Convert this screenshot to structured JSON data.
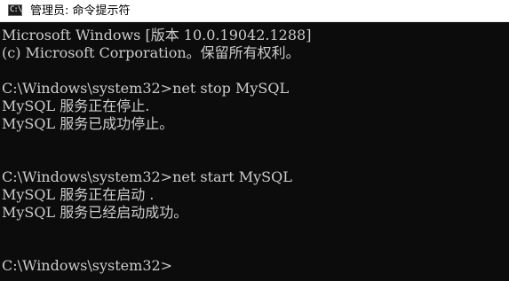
{
  "window": {
    "title": "管理员: 命令提示符",
    "icon": "cmd-icon",
    "icon_glyph": "C:\\"
  },
  "console": {
    "lines": [
      "Microsoft Windows [版本 10.0.19042.1288]",
      "(c) Microsoft Corporation。保留所有权利。",
      "",
      "C:\\Windows\\system32>net stop MySQL",
      "MySQL 服务正在停止.",
      "MySQL 服务已成功停止。",
      "",
      "",
      "C:\\Windows\\system32>net start MySQL",
      "MySQL 服务正在启动 .",
      "MySQL 服务已经启动成功。",
      "",
      "",
      "C:\\Windows\\system32>"
    ]
  },
  "colors": {
    "console_background": "#0c0c0c",
    "console_text": "#cccccc",
    "titlebar_background": "#ffffff"
  }
}
